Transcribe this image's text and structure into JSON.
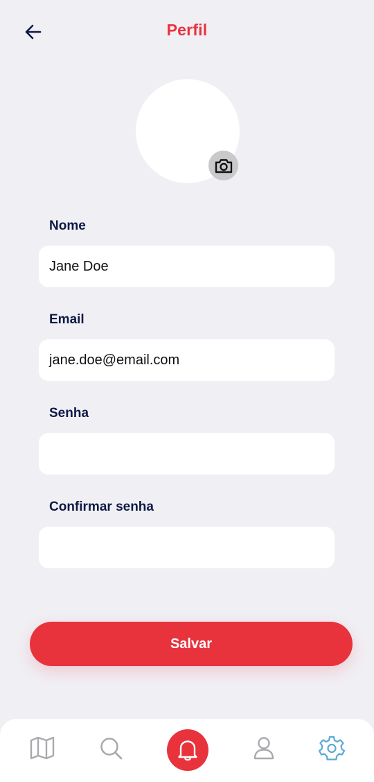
{
  "header": {
    "title": "Perfil",
    "back_icon": "arrow-left-icon"
  },
  "avatar": {
    "camera_icon": "camera-icon"
  },
  "form": {
    "name_label": "Nome",
    "name_value": "Jane Doe",
    "email_label": "Email",
    "email_value": "jane.doe@email.com",
    "password_label": "Senha",
    "password_value": "",
    "confirm_label": "Confirmar senha",
    "confirm_value": ""
  },
  "actions": {
    "save_label": "Salvar"
  },
  "tab_bar": {
    "items": [
      {
        "icon": "map-icon",
        "active": false
      },
      {
        "icon": "search-icon",
        "active": false
      },
      {
        "icon": "bell-icon",
        "active": true,
        "highlighted": true
      },
      {
        "icon": "user-icon",
        "active": false
      },
      {
        "icon": "gear-icon",
        "active": true
      }
    ]
  },
  "colors": {
    "accent": "#E8323C",
    "label": "#0E1A45",
    "background": "#F0EFF4",
    "icon_muted": "#A9A9AE",
    "icon_active": "#5AA9D6"
  }
}
